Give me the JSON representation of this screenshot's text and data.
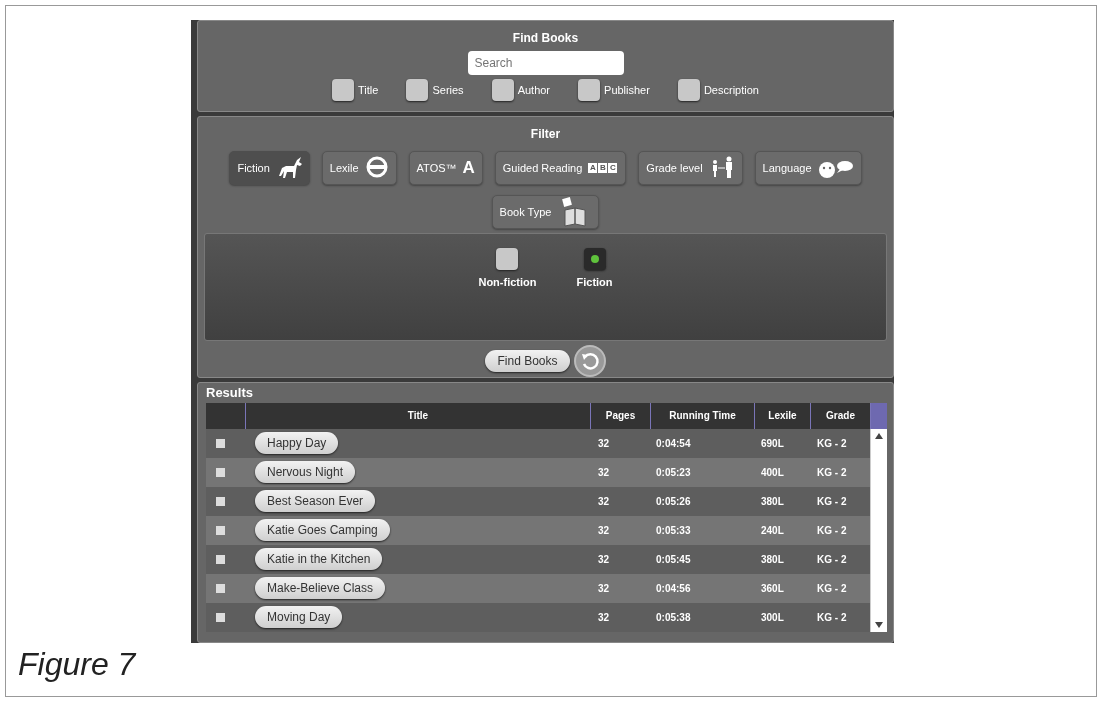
{
  "find_books": {
    "title": "Find Books",
    "search": {
      "placeholder": "Search"
    },
    "fields": [
      {
        "label": "Title",
        "checked": false
      },
      {
        "label": "Series",
        "checked": false
      },
      {
        "label": "Author",
        "checked": false
      },
      {
        "label": "Publisher",
        "checked": false
      },
      {
        "label": "Description",
        "checked": false
      }
    ]
  },
  "filter": {
    "title": "Filter",
    "buttons": [
      {
        "label": "Fiction",
        "kind": "unicorn",
        "selected": true
      },
      {
        "label": "Lexile",
        "kind": "lexile",
        "selected": false
      },
      {
        "label": "ATOS™",
        "kind": "letter",
        "glyphs": [
          "A"
        ],
        "selected": false
      },
      {
        "label": "Guided Reading",
        "kind": "blocks",
        "glyphs": [
          "A",
          "B",
          "C"
        ],
        "selected": false
      },
      {
        "label": "Grade level",
        "kind": "people",
        "selected": false
      },
      {
        "label": "Language",
        "kind": "speech",
        "selected": false
      },
      {
        "label": "Book Type",
        "kind": "books",
        "selected": false
      }
    ],
    "options": [
      {
        "label": "Non-fiction",
        "checked": false
      },
      {
        "label": "Fiction",
        "checked": true
      }
    ],
    "find_button": "Find Books"
  },
  "results": {
    "title": "Results",
    "columns": [
      "Title",
      "Pages",
      "Running Time",
      "Lexile",
      "Grade"
    ],
    "rows": [
      {
        "title": "Happy Day",
        "pages": "32",
        "running_time": "0:04:54",
        "lexile": "690L",
        "grade": "KG - 2",
        "checked": false
      },
      {
        "title": "Nervous Night",
        "pages": "32",
        "running_time": "0:05:23",
        "lexile": "400L",
        "grade": "KG - 2",
        "checked": false
      },
      {
        "title": "Best Season Ever",
        "pages": "32",
        "running_time": "0:05:26",
        "lexile": "380L",
        "grade": "KG - 2",
        "checked": false
      },
      {
        "title": "Katie Goes Camping",
        "pages": "32",
        "running_time": "0:05:33",
        "lexile": "240L",
        "grade": "KG - 2",
        "checked": false
      },
      {
        "title": "Katie in the Kitchen",
        "pages": "32",
        "running_time": "0:05:45",
        "lexile": "380L",
        "grade": "KG - 2",
        "checked": false
      },
      {
        "title": "Make-Believe Class",
        "pages": "32",
        "running_time": "0:04:56",
        "lexile": "360L",
        "grade": "KG - 2",
        "checked": false
      },
      {
        "title": "Moving Day",
        "pages": "32",
        "running_time": "0:05:38",
        "lexile": "300L",
        "grade": "KG - 2",
        "checked": false
      }
    ]
  },
  "caption": "Figure 7"
}
